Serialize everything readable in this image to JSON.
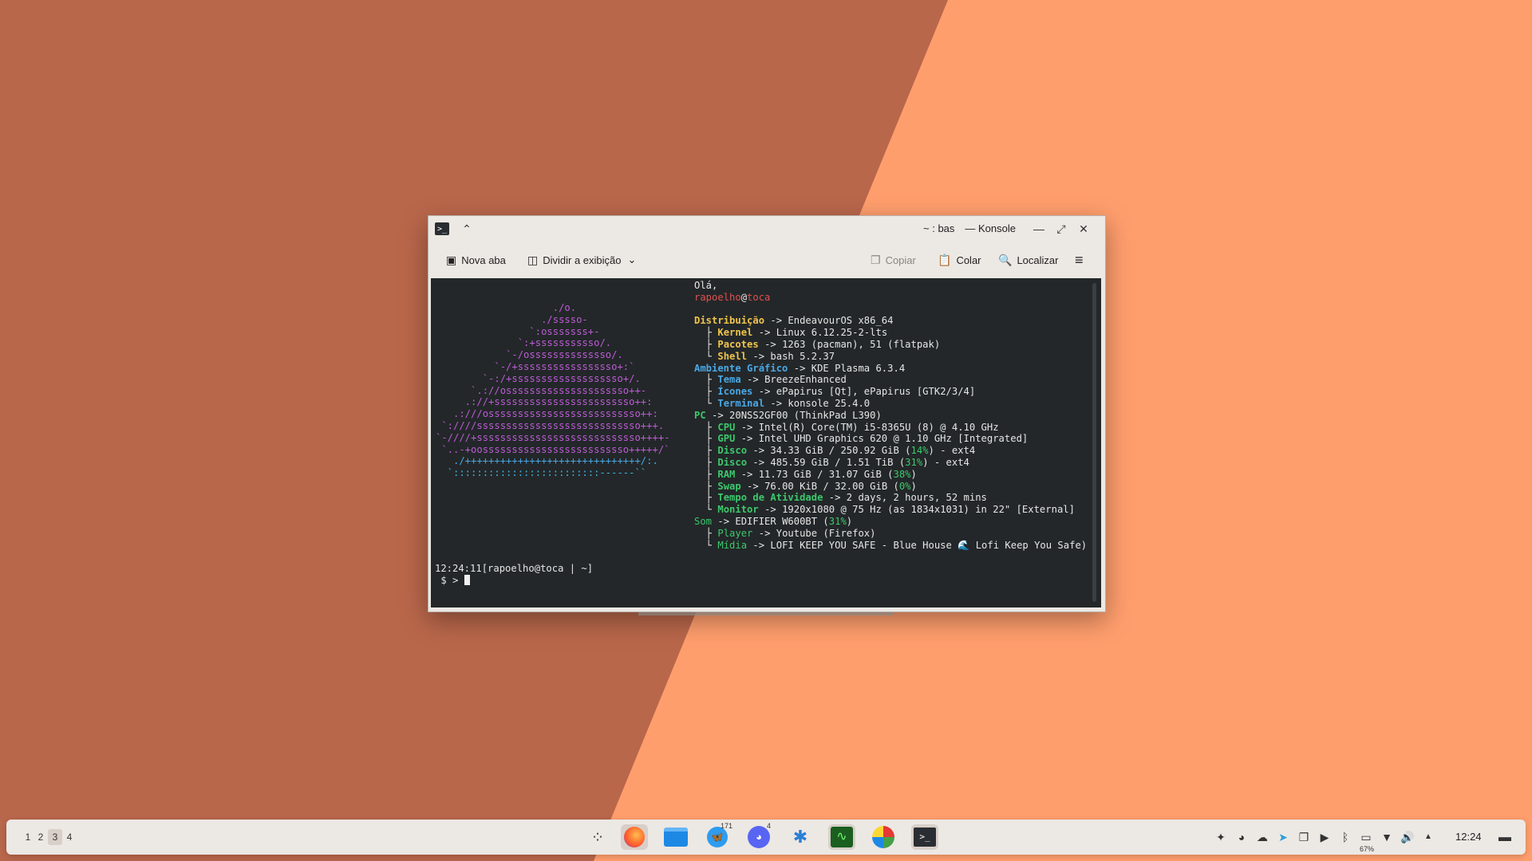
{
  "window": {
    "title": "~ : bash — Konsole",
    "title_display": "~ : bas — Konsole"
  },
  "toolbar": {
    "new_tab": "Nova aba",
    "split_view": "Dividir a exibição",
    "copy": "Copiar",
    "paste": "Colar",
    "find": "Localizar"
  },
  "terminal": {
    "logo_lines": [
      {
        "t": "                    ./o.",
        "c": "purple"
      },
      {
        "t": "                  ./sssso-",
        "c": "purple"
      },
      {
        "t": "                `:osssssss+-",
        "c": "purple"
      },
      {
        "t": "              `:+sssssssssso/.",
        "c": "purple"
      },
      {
        "t": "            `-/ossssssssssssso/.",
        "c": "purple"
      },
      {
        "t": "          `-/+sssssssssssssssso+:`",
        "c": "purple"
      },
      {
        "t": "        `-:/+sssssssssssssssssso+/.",
        "c": "purple"
      },
      {
        "t": "      `.://osssssssssssssssssssso++-",
        "c": "purple"
      },
      {
        "t": "     .://+ssssssssssssssssssssssso++:",
        "c": "purple"
      },
      {
        "t": "   .:///ossssssssssssssssssssssssso++:",
        "c": "purple"
      },
      {
        "t": " `:////ssssssssssssssssssssssssssso+++.",
        "c": "purple"
      },
      {
        "t": "`-////+ssssssssssssssssssssssssssso++++-",
        "c": "purple"
      },
      {
        "t": " `..-+oosssssssssssssssssssssssso+++++/`",
        "c": "purple"
      },
      {
        "t": "   ./++++++++++++++++++++++++++++++/:.",
        "c": "blue"
      },
      {
        "t": "  `:::::::::::::::::::::::::------``",
        "c": "cyan"
      }
    ],
    "info_lines": [
      [
        {
          "t": "Olá,",
          "c": "tree"
        }
      ],
      [
        {
          "t": "rapoelho",
          "c": "red"
        },
        {
          "t": "@",
          "c": "tree"
        },
        {
          "t": "toca",
          "c": "red"
        }
      ],
      [
        {
          "t": "",
          "c": "tree"
        }
      ],
      [
        {
          "t": "Distribuição",
          "c": "yellow"
        },
        {
          "t": " -> EndeavourOS x86_64",
          "c": "tree"
        }
      ],
      [
        {
          "t": "  ├ ",
          "c": "tree"
        },
        {
          "t": "Kernel",
          "c": "yellow"
        },
        {
          "t": " -> Linux 6.12.25-2-lts",
          "c": "tree"
        }
      ],
      [
        {
          "t": "  ├ ",
          "c": "tree"
        },
        {
          "t": "Pacotes",
          "c": "yellow"
        },
        {
          "t": " -> 1263 (pacman), 51 (flatpak)",
          "c": "tree"
        }
      ],
      [
        {
          "t": "  └ ",
          "c": "tree"
        },
        {
          "t": "Shell",
          "c": "yellow"
        },
        {
          "t": " -> bash 5.2.37",
          "c": "tree"
        }
      ],
      [
        {
          "t": "Ambiente Gráfico",
          "c": "headblue"
        },
        {
          "t": " -> KDE Plasma 6.3.4",
          "c": "tree"
        }
      ],
      [
        {
          "t": "  ├ ",
          "c": "tree"
        },
        {
          "t": "Tema",
          "c": "headblue"
        },
        {
          "t": " -> BreezeEnhanced",
          "c": "tree"
        }
      ],
      [
        {
          "t": "  ├ ",
          "c": "tree"
        },
        {
          "t": "Ícones",
          "c": "headblue"
        },
        {
          "t": " -> ePapirus [Qt], ePapirus [GTK2/3/4]",
          "c": "tree"
        }
      ],
      [
        {
          "t": "  └ ",
          "c": "tree"
        },
        {
          "t": "Terminal",
          "c": "headblue"
        },
        {
          "t": " -> konsole 25.4.0",
          "c": "tree"
        }
      ],
      [
        {
          "t": "PC",
          "c": "greenhead"
        },
        {
          "t": " -> 20NSS2GF00 (ThinkPad L390)",
          "c": "tree"
        }
      ],
      [
        {
          "t": "  ├ ",
          "c": "tree"
        },
        {
          "t": "CPU",
          "c": "greenhead"
        },
        {
          "t": " -> Intel(R) Core(TM) i5-8365U (8) @ 4.10 GHz",
          "c": "tree"
        }
      ],
      [
        {
          "t": "  ├ ",
          "c": "tree"
        },
        {
          "t": "GPU",
          "c": "greenhead"
        },
        {
          "t": " -> Intel UHD Graphics 620 @ 1.10 GHz [Integrated]",
          "c": "tree"
        }
      ],
      [
        {
          "t": "  ├ ",
          "c": "tree"
        },
        {
          "t": "Disco",
          "c": "greenhead"
        },
        {
          "t": " -> 34.33 GiB / 250.92 GiB (",
          "c": "tree"
        },
        {
          "t": "14%",
          "c": "greenn"
        },
        {
          "t": ") - ext4",
          "c": "tree"
        }
      ],
      [
        {
          "t": "  ├ ",
          "c": "tree"
        },
        {
          "t": "Disco",
          "c": "greenhead"
        },
        {
          "t": " -> 485.59 GiB / 1.51 TiB (",
          "c": "tree"
        },
        {
          "t": "31%",
          "c": "greenn"
        },
        {
          "t": ") - ext4",
          "c": "tree"
        }
      ],
      [
        {
          "t": "  ├ ",
          "c": "tree"
        },
        {
          "t": "RAM",
          "c": "greenhead"
        },
        {
          "t": " -> 11.73 GiB / 31.07 GiB (",
          "c": "tree"
        },
        {
          "t": "38%",
          "c": "greenn"
        },
        {
          "t": ")",
          "c": "tree"
        }
      ],
      [
        {
          "t": "  ├ ",
          "c": "tree"
        },
        {
          "t": "Swap",
          "c": "greenhead"
        },
        {
          "t": " -> 76.00 KiB / 32.00 GiB (",
          "c": "tree"
        },
        {
          "t": "0%",
          "c": "greenn"
        },
        {
          "t": ")",
          "c": "tree"
        }
      ],
      [
        {
          "t": "  ├ ",
          "c": "tree"
        },
        {
          "t": "Tempo de Atividade",
          "c": "greenhead"
        },
        {
          "t": " -> 2 days, 2 hours, 52 mins",
          "c": "tree"
        }
      ],
      [
        {
          "t": "  └ ",
          "c": "tree"
        },
        {
          "t": "Monitor",
          "c": "greenhead"
        },
        {
          "t": " -> 1920x1080 @ 75 Hz (as 1834x1031) in 22\" [External]",
          "c": "tree"
        }
      ],
      [
        {
          "t": "Som",
          "c": "greenn"
        },
        {
          "t": " -> EDIFIER W600BT (",
          "c": "tree"
        },
        {
          "t": "31%",
          "c": "greenn"
        },
        {
          "t": ")",
          "c": "tree"
        }
      ],
      [
        {
          "t": "  ├ ",
          "c": "tree"
        },
        {
          "t": "Player",
          "c": "greenn"
        },
        {
          "t": " -> Youtube (Firefox)",
          "c": "tree"
        }
      ],
      [
        {
          "t": "  └ ",
          "c": "tree"
        },
        {
          "t": "Mídia",
          "c": "greenn"
        },
        {
          "t": " -> LOFI KEEP YOU SAFE - Blue House 🌊 Lofi Keep You Safe)",
          "c": "tree"
        }
      ]
    ],
    "prompt_line1": "12:24:11[rapoelho@toca | ~]",
    "prompt_line2": " $ > "
  },
  "taskbar": {
    "desktops": [
      "1",
      "2",
      "3",
      "4"
    ],
    "active_desktop": "3",
    "app_badges": {
      "bluesky": "171",
      "discord": "4"
    },
    "battery_percent": "67%",
    "clock": "12:24"
  },
  "colors": {
    "wallpaper_light": "#ff9e6d",
    "wallpaper_dark": "#b9674b",
    "terminal_bg": "#232729"
  }
}
